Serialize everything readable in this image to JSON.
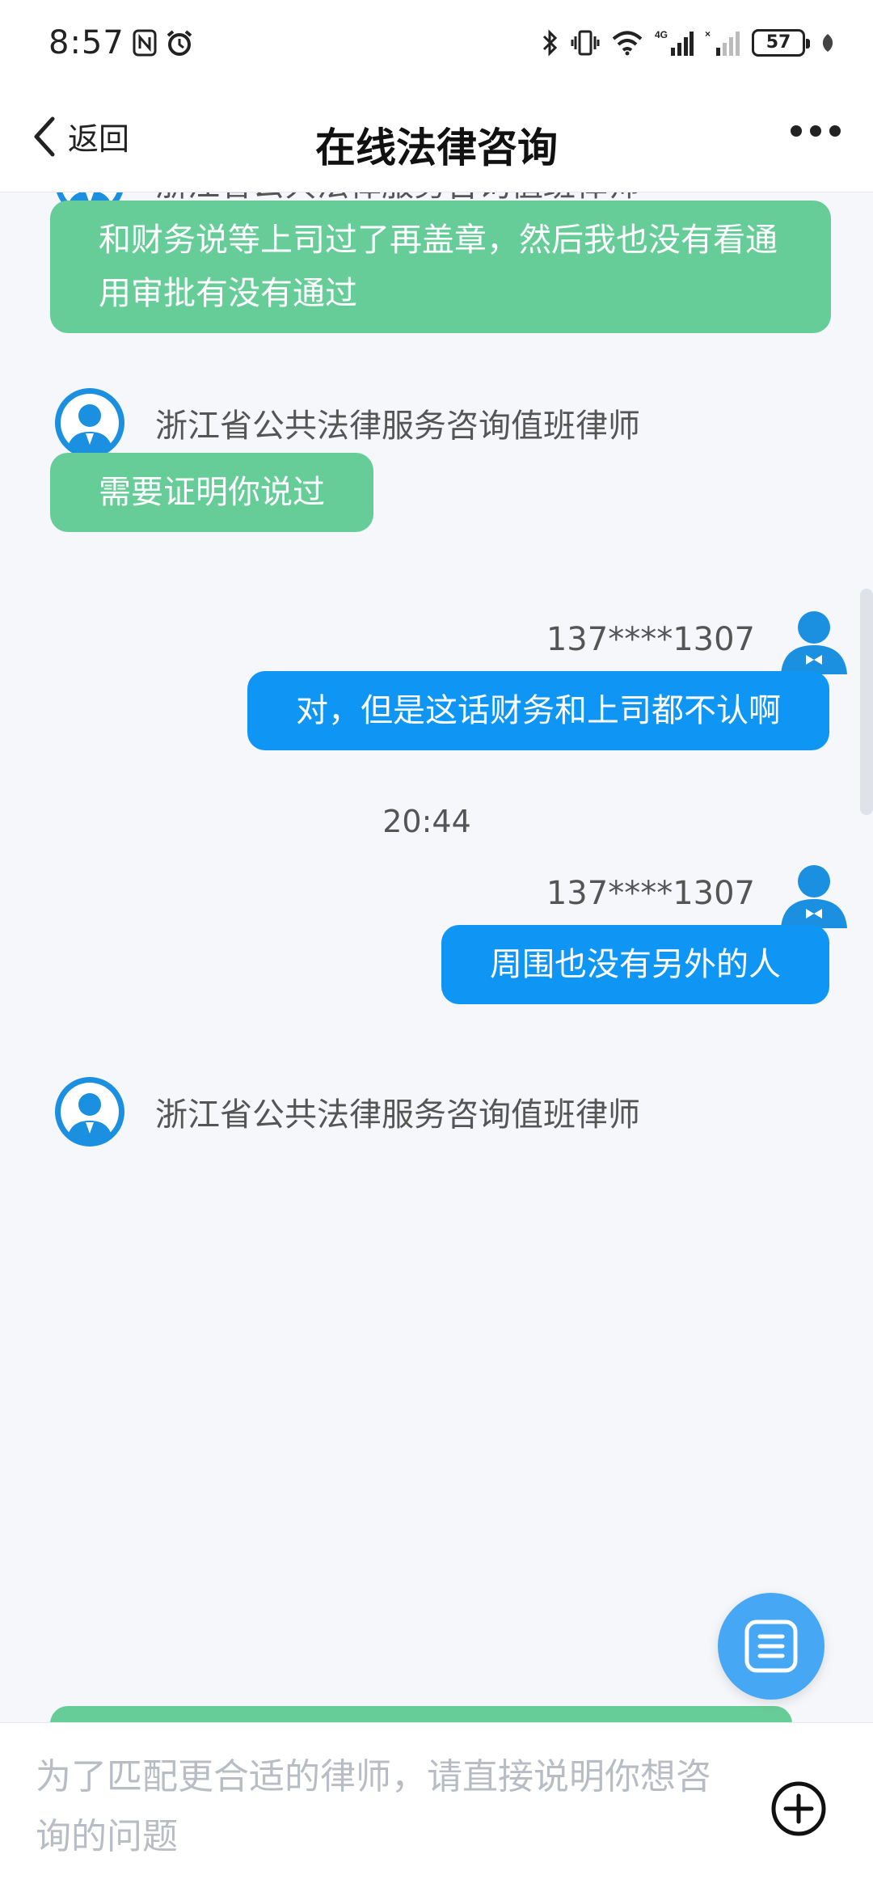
{
  "status_bar": {
    "time": "8:57",
    "battery": "57",
    "icons": [
      "nfc-icon",
      "alarm-icon",
      "bluetooth-icon",
      "vibrate-icon",
      "wifi-icon",
      "signal-4g-icon",
      "signal-icon",
      "leaf-icon"
    ]
  },
  "header": {
    "back_label": "返回",
    "title": "在线法律咨询"
  },
  "messages": {
    "m1_sender": "浙江省公共法律服务咨询值班律师",
    "m1_text": "和财务说等上司过了再盖章，然后我也没有看通用审批有没有通过",
    "m2_sender": "浙江省公共法律服务咨询值班律师",
    "m2_text": "需要证明你说过",
    "m3_sender": "137****1307",
    "m3_text": "对，但是这话财务和上司都不认啊",
    "time_sep": "20:44",
    "m4_sender": "137****1307",
    "m4_text": "周围也没有另外的人",
    "m5_sender": "浙江省公共法律服务咨询值班律师"
  },
  "input": {
    "placeholder": "为了匹配更合适的律师，请直接说明你想咨询的问题"
  },
  "colors": {
    "lawyer_bubble": "#67cd98",
    "user_bubble": "#0f96f5",
    "fab": "#46a7f4",
    "background": "#f5f7fb"
  }
}
